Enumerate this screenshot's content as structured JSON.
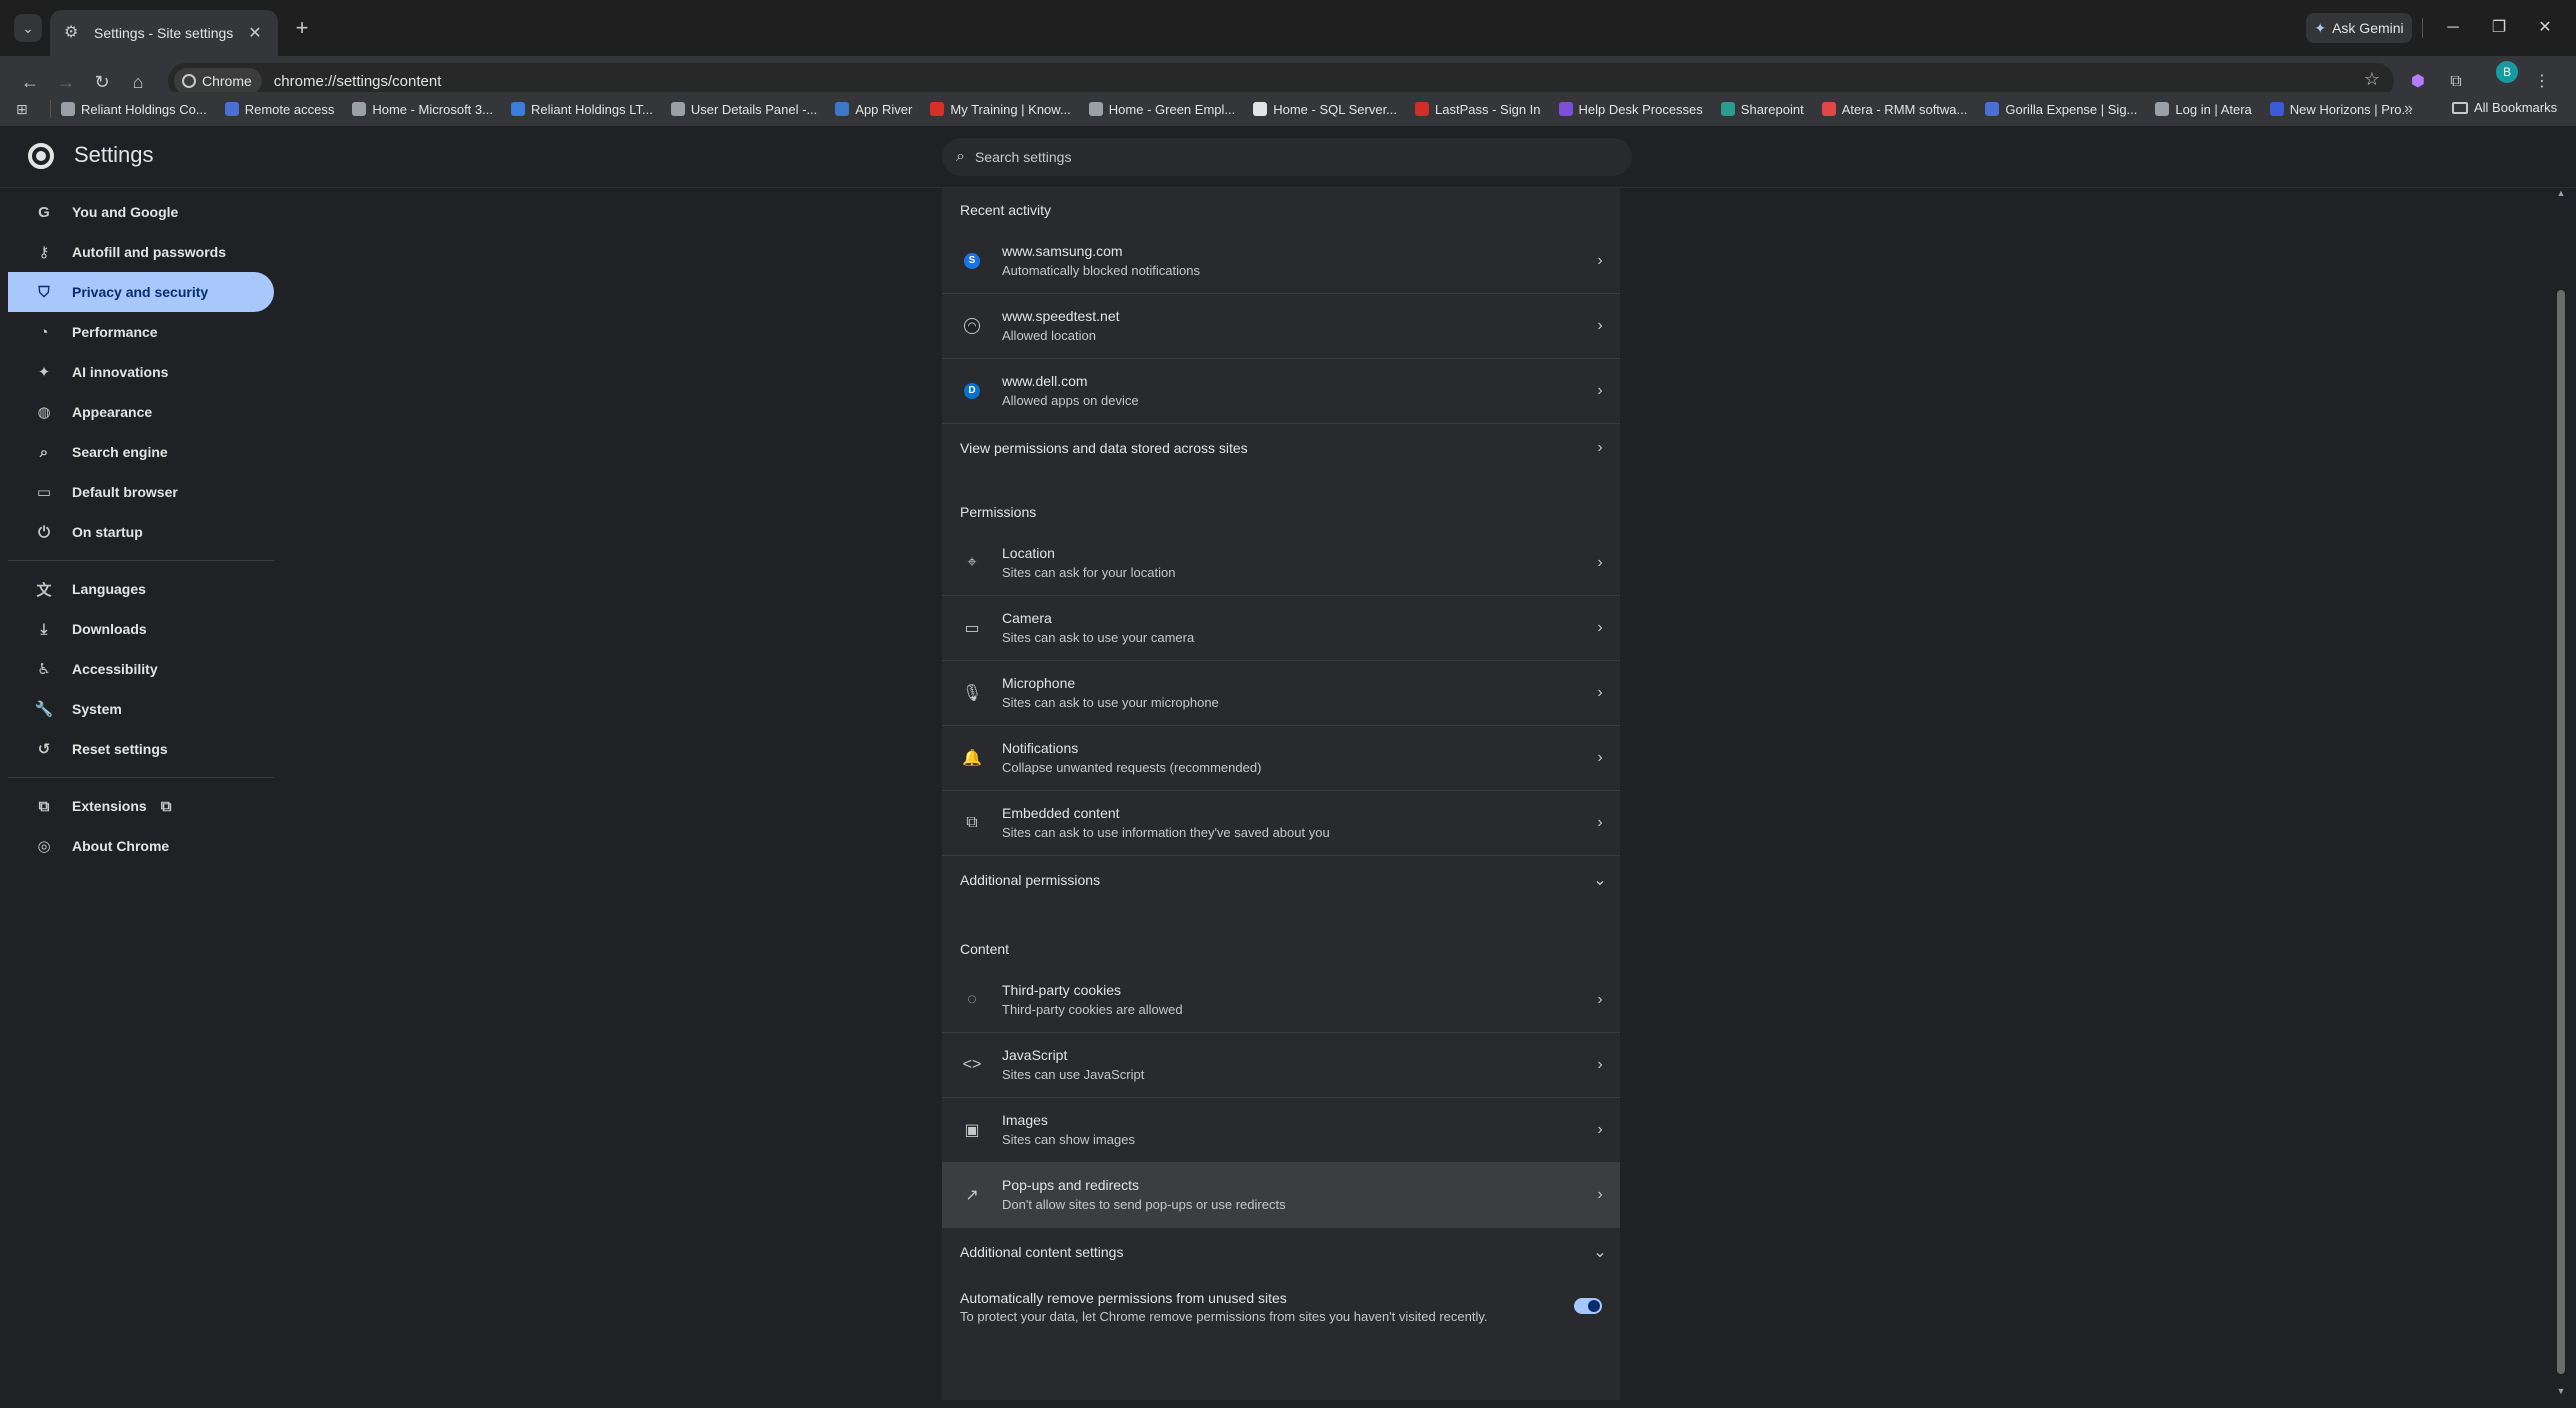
{
  "browser": {
    "tab_title": "Settings - Site settings",
    "gemini_label": "Ask Gemini",
    "chip_label": "Chrome",
    "url": "chrome://settings/content",
    "avatar_letter": "B"
  },
  "bookmarks": {
    "items": [
      {
        "label": "Reliant Holdings Co...",
        "color": "#9aa0a6"
      },
      {
        "label": "Remote access",
        "color": "#4a6fd6"
      },
      {
        "label": "Home - Microsoft 3...",
        "color": "#9aa0a6"
      },
      {
        "label": "Reliant Holdings LT...",
        "color": "#3b7ddd"
      },
      {
        "label": "User Details Panel -...",
        "color": "#9aa0a6"
      },
      {
        "label": "App River",
        "color": "#3a78c9"
      },
      {
        "label": "My Training | Know...",
        "color": "#d93025"
      },
      {
        "label": "Home - Green Empl...",
        "color": "#9aa0a6"
      },
      {
        "label": "Home - SQL Server...",
        "color": "#e3e3e3"
      },
      {
        "label": "LastPass - Sign In",
        "color": "#d32d27"
      },
      {
        "label": "Help Desk Processes",
        "color": "#7b4fd6"
      },
      {
        "label": "Sharepoint",
        "color": "#2a9d8f"
      },
      {
        "label": "Atera - RMM softwa...",
        "color": "#e04848"
      },
      {
        "label": "Gorilla Expense | Sig...",
        "color": "#4a6fd6"
      },
      {
        "label": "Log in | Atera",
        "color": "#9aa0a6"
      },
      {
        "label": "New Horizons | Pro...",
        "color": "#3b5bd6"
      }
    ],
    "all_label": "All Bookmarks"
  },
  "settings": {
    "title": "Settings",
    "search_placeholder": "Search settings"
  },
  "sidebar": {
    "group1": [
      {
        "label": "You and Google",
        "icon": "google-icon",
        "glyph": "G"
      },
      {
        "label": "Autofill and passwords",
        "icon": "key-icon",
        "glyph": "⚷"
      },
      {
        "label": "Privacy and security",
        "icon": "shield-icon",
        "glyph": "⛉",
        "active": true
      },
      {
        "label": "Performance",
        "icon": "speedometer-icon",
        "glyph": "◔"
      },
      {
        "label": "AI innovations",
        "icon": "sparkle-icon",
        "glyph": "✦"
      },
      {
        "label": "Appearance",
        "icon": "palette-icon",
        "glyph": "◍"
      },
      {
        "label": "Search engine",
        "icon": "search-icon",
        "glyph": "⌕"
      },
      {
        "label": "Default browser",
        "icon": "browser-icon",
        "glyph": "▭"
      },
      {
        "label": "On startup",
        "icon": "power-icon",
        "glyph": "⏻"
      }
    ],
    "group2": [
      {
        "label": "Languages",
        "icon": "translate-icon",
        "glyph": "文"
      },
      {
        "label": "Downloads",
        "icon": "download-icon",
        "glyph": "⤓"
      },
      {
        "label": "Accessibility",
        "icon": "accessibility-icon",
        "glyph": "♿"
      },
      {
        "label": "System",
        "icon": "wrench-icon",
        "glyph": "🔧"
      },
      {
        "label": "Reset settings",
        "icon": "reset-icon",
        "glyph": "↺"
      }
    ],
    "group3": [
      {
        "label": "Extensions",
        "icon": "puzzle-icon",
        "glyph": "⧉"
      },
      {
        "label": "About Chrome",
        "icon": "chrome-icon",
        "glyph": "◎"
      }
    ]
  },
  "main": {
    "recent_activity": {
      "heading": "Recent activity",
      "items": [
        {
          "title": "www.samsung.com",
          "subtitle": "Automatically blocked notifications",
          "icon_letter": "S",
          "icon_color": "#1a73e8"
        },
        {
          "title": "www.speedtest.net",
          "subtitle": "Allowed location",
          "icon_letter": "◠",
          "icon_color": "#202124"
        },
        {
          "title": "www.dell.com",
          "subtitle": "Allowed apps on device",
          "icon_letter": "D",
          "icon_color": "#0672cb"
        }
      ],
      "view_all": "View permissions and data stored across sites"
    },
    "permissions": {
      "heading": "Permissions",
      "items": [
        {
          "title": "Location",
          "subtitle": "Sites can ask for your location",
          "icon": "location-icon",
          "glyph": "⌖"
        },
        {
          "title": "Camera",
          "subtitle": "Sites can ask to use your camera",
          "icon": "camera-icon",
          "glyph": "▭"
        },
        {
          "title": "Microphone",
          "subtitle": "Sites can ask to use your microphone",
          "icon": "microphone-icon",
          "glyph": "🎙"
        },
        {
          "title": "Notifications",
          "subtitle": "Collapse unwanted requests (recommended)",
          "icon": "bell-icon",
          "glyph": "🔔"
        },
        {
          "title": "Embedded content",
          "subtitle": "Sites can ask to use information they've saved about you",
          "icon": "embedded-icon",
          "glyph": "⧉"
        }
      ],
      "additional": "Additional permissions"
    },
    "content": {
      "heading": "Content",
      "items": [
        {
          "title": "Third-party cookies",
          "subtitle": "Third-party cookies are allowed",
          "icon": "cookie-icon",
          "glyph": "◌"
        },
        {
          "title": "JavaScript",
          "subtitle": "Sites can use JavaScript",
          "icon": "code-icon",
          "glyph": "<>"
        },
        {
          "title": "Images",
          "subtitle": "Sites can show images",
          "icon": "image-icon",
          "glyph": "▣"
        },
        {
          "title": "Pop-ups and redirects",
          "subtitle": "Don't allow sites to send pop-ups or use redirects",
          "icon": "popup-icon",
          "glyph": "↗"
        }
      ],
      "additional": "Additional content settings"
    },
    "auto_remove": {
      "title": "Automatically remove permissions from unused sites",
      "subtitle": "To protect your data, let Chrome remove permissions from sites you haven't visited recently.",
      "enabled": true
    }
  }
}
